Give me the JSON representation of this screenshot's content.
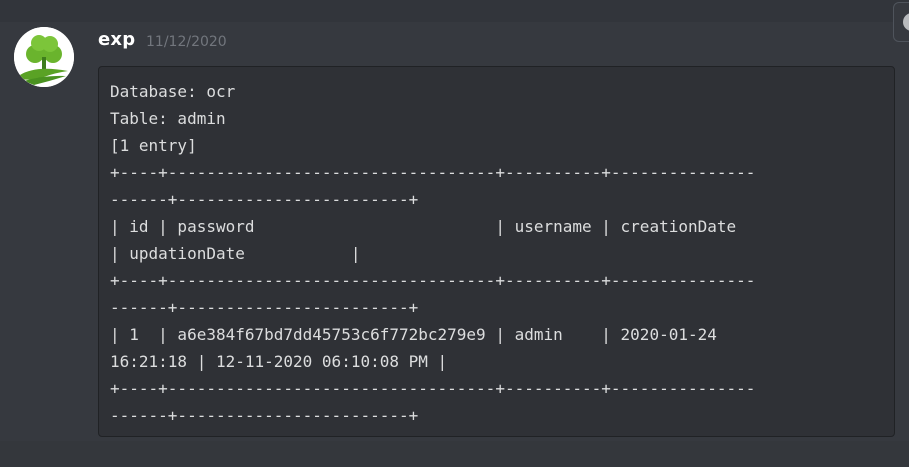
{
  "message": {
    "author": "exp",
    "timestamp": "11/12/2020",
    "avatar_icon": "tree-logo-icon",
    "code_lines": [
      "Database: ocr",
      "Table: admin",
      "[1 entry]",
      "+----+----------------------------------+----------+---------------",
      "------+------------------------+",
      "| id | password                         | username | creationDate",
      "| updationDate           |",
      "+----+----------------------------------+----------+---------------",
      "------+------------------------+",
      "| 1  | a6e384f67bd7dd45753c6f772bc279e9 | admin    | 2020-01-24",
      "16:21:18 | 12-11-2020 06:10:08 PM |",
      "+----+----------------------------------+----------+---------------",
      "------+------------------------+"
    ]
  },
  "colors": {
    "background": "#36393f",
    "codeblock_bg": "#2f3136",
    "author": "#ffffff",
    "timestamp": "#72767d",
    "code_text": "#dcddde",
    "avatar_tree": "#6ab42d"
  }
}
